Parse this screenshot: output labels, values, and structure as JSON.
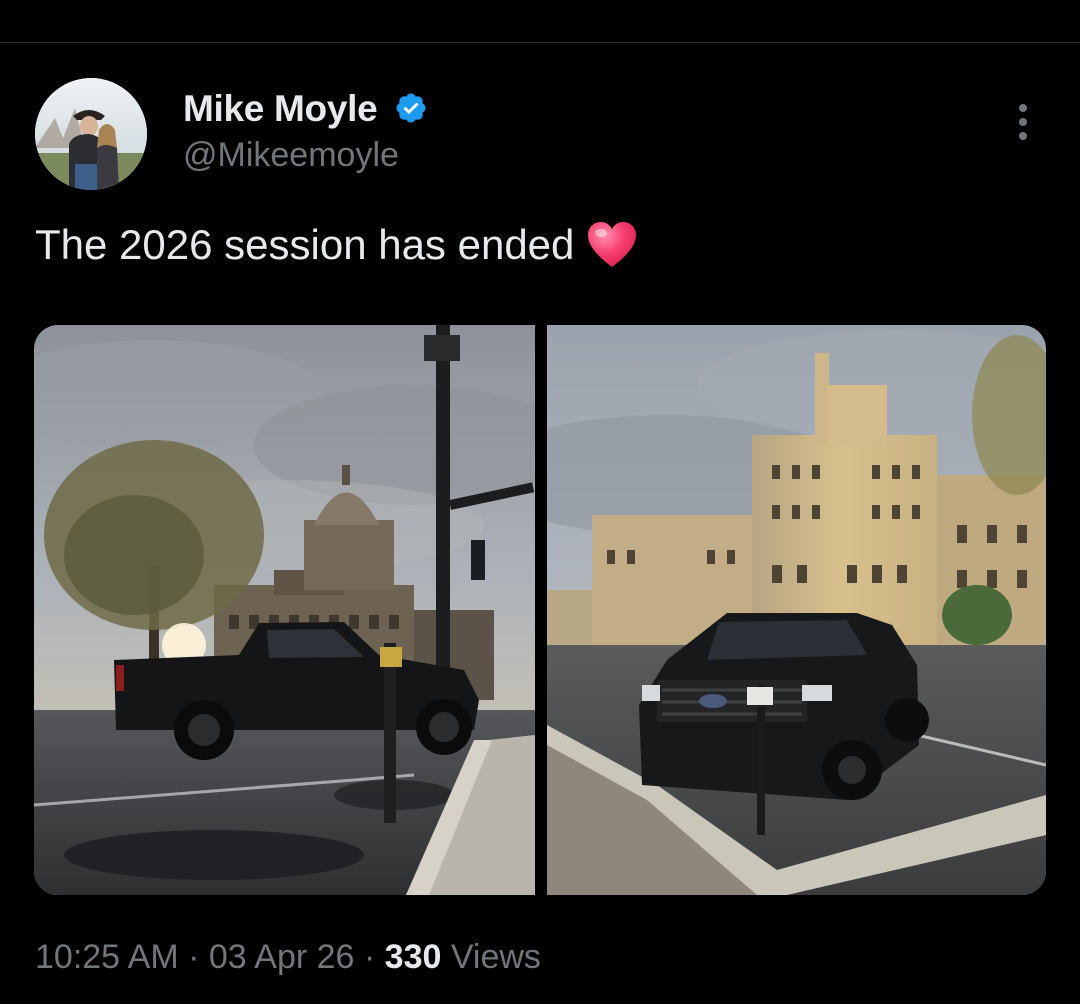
{
  "author": {
    "display_name": "Mike Moyle",
    "handle": "@Mikeemoyle",
    "verified": true,
    "verified_icon": "verified-badge-icon"
  },
  "tweet": {
    "text": "The 2026 session has ended",
    "emoji_icon": "red-heart-emoji-icon"
  },
  "media": {
    "count": 2
  },
  "meta": {
    "time": "10:25 AM",
    "separator": " · ",
    "date": "03 Apr 26",
    "views_count": "330",
    "views_label": " Views"
  },
  "colors": {
    "background": "#000000",
    "primary_text": "#e7e9ea",
    "secondary_text": "#71767b",
    "verified_blue": "#1d9bf0",
    "heart_red": "#f91880"
  },
  "icons": {
    "more": "more-vertical-icon"
  }
}
